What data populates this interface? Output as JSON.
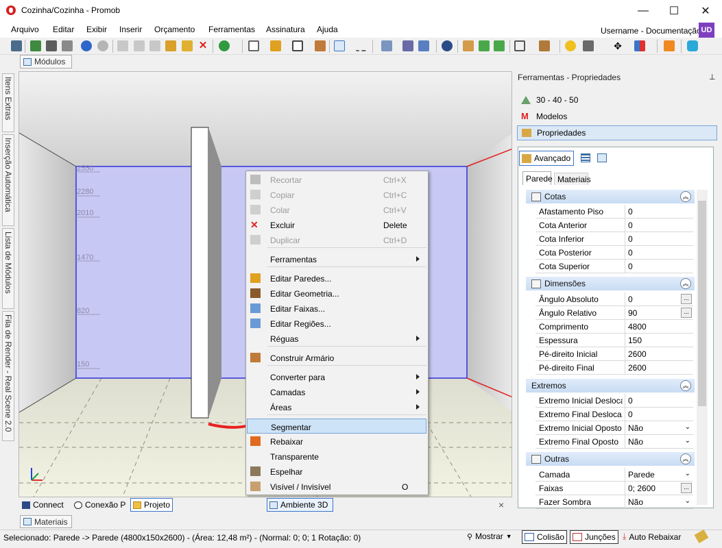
{
  "window": {
    "title": "Cozinha/Cozinha - Promob",
    "minimize": "—",
    "maximize": "☐",
    "close": "✕"
  },
  "menubar": {
    "items": [
      "Arquivo",
      "Editar",
      "Exibir",
      "Inserir",
      "Orçamento",
      "Ferramentas",
      "Assinatura",
      "Ajuda"
    ],
    "user": "Username - Documentação",
    "user_initials": "UD"
  },
  "tabs": {
    "modulos": "Módulos",
    "materiais": "Materiais"
  },
  "left_tabs": [
    "Itens Extras",
    "Inserção Automática",
    "Lista de Módulos",
    "Fila de Render - Real Scene 2.0"
  ],
  "viewport": {
    "ruler_labels": [
      "2550",
      "2280",
      "2010",
      "1470",
      "820",
      "150"
    ]
  },
  "bottom_tabs": {
    "connect": "Connect",
    "conexao": "Conexão P",
    "projeto": "Projeto",
    "ambiente": "Ambiente 3D",
    "close": "×"
  },
  "context_menu": {
    "items": [
      {
        "label": "Recortar",
        "shortcut": "Ctrl+X",
        "icon": "scissors-icon",
        "enabled": false
      },
      {
        "label": "Copiar",
        "shortcut": "Ctrl+C",
        "icon": "copy-icon",
        "enabled": false
      },
      {
        "label": "Colar",
        "shortcut": "Ctrl+V",
        "icon": "paste-icon",
        "enabled": false
      },
      {
        "label": "Excluir",
        "shortcut": "Delete",
        "icon": "delete-icon",
        "enabled": true
      },
      {
        "label": "Duplicar",
        "shortcut": "Ctrl+D",
        "icon": "duplicate-icon",
        "enabled": false
      },
      {
        "label": "Ferramentas",
        "submenu": true,
        "enabled": true
      },
      {
        "label": "Editar Paredes...",
        "icon": "walls-icon",
        "enabled": true
      },
      {
        "label": "Editar Geometria...",
        "icon": "geometry-icon",
        "enabled": true
      },
      {
        "label": "Editar Faixas...",
        "icon": "bands-icon",
        "enabled": true
      },
      {
        "label": "Editar Regiões...",
        "icon": "regions-icon",
        "enabled": true
      },
      {
        "label": "Réguas",
        "submenu": true,
        "enabled": true
      },
      {
        "label": "Construir Armário",
        "icon": "cabinet-icon",
        "enabled": true
      },
      {
        "label": "Converter para",
        "submenu": true,
        "enabled": true
      },
      {
        "label": "Camadas",
        "submenu": true,
        "enabled": true
      },
      {
        "label": "Áreas",
        "submenu": true,
        "enabled": true
      },
      {
        "label": "Segmentar",
        "enabled": true,
        "highlighted": true
      },
      {
        "label": "Rebaixar",
        "icon": "lower-icon",
        "enabled": true
      },
      {
        "label": "Transparente",
        "enabled": true
      },
      {
        "label": "Espelhar",
        "icon": "mirror-icon",
        "enabled": true
      },
      {
        "label": "Visível / Invisível",
        "shortcut": "O",
        "icon": "visibility-icon",
        "enabled": true
      }
    ]
  },
  "panel": {
    "title": "Ferramentas - Propriedades",
    "pin": "⊥",
    "items": [
      "30 - 40 - 50",
      "Modelos",
      "Propriedades"
    ],
    "advanced": "Avançado",
    "tabs": [
      "Parede",
      "Materiais"
    ],
    "sections": {
      "cotas": {
        "label": "Cotas",
        "rows": [
          [
            "Afastamento Piso",
            "0"
          ],
          [
            "Cota Anterior",
            "0"
          ],
          [
            "Cota Inferior",
            "0"
          ],
          [
            "Cota Posterior",
            "0"
          ],
          [
            "Cota Superior",
            "0"
          ]
        ]
      },
      "dimensoes": {
        "label": "Dimensões",
        "rows": [
          [
            "Ângulo Absoluto",
            "0"
          ],
          [
            "Ângulo Relativo",
            "90"
          ],
          [
            "Comprimento",
            "4800"
          ],
          [
            "Espessura",
            "150"
          ],
          [
            "Pé-direito Inicial",
            "2600"
          ],
          [
            "Pé-direito Final",
            "2600"
          ]
        ]
      },
      "extremos": {
        "label": "Extremos",
        "rows": [
          [
            "Extremo Inicial Desloca...",
            "0"
          ],
          [
            "Extremo Final Desloca...",
            "0"
          ],
          [
            "Extremo Inicial Oposto",
            "Não"
          ],
          [
            "Extremo Final Oposto",
            "Não"
          ]
        ]
      },
      "outras": {
        "label": "Outras",
        "rows": [
          [
            "Camada",
            "Parede"
          ],
          [
            "Faixas",
            "0; 2600"
          ],
          [
            "Fazer Sombra",
            "Não"
          ]
        ]
      }
    }
  },
  "status": {
    "text": "Selecionado: Parede -> Parede (4800x150x2600) - (Área: 12,48 m²) - (Normal: 0; 0; 1 Rotação: 0)",
    "mostrar": "Mostrar",
    "colisao": "Colisão",
    "juncoes": "Junções",
    "auto_rebaixar": "Auto Rebaixar"
  },
  "colors": {
    "accent": "#3a74c9",
    "highlight": "#cde3f7",
    "wall": "#c8c8f5",
    "floor": "#efefd7",
    "red_arrow": "#e8201f"
  }
}
